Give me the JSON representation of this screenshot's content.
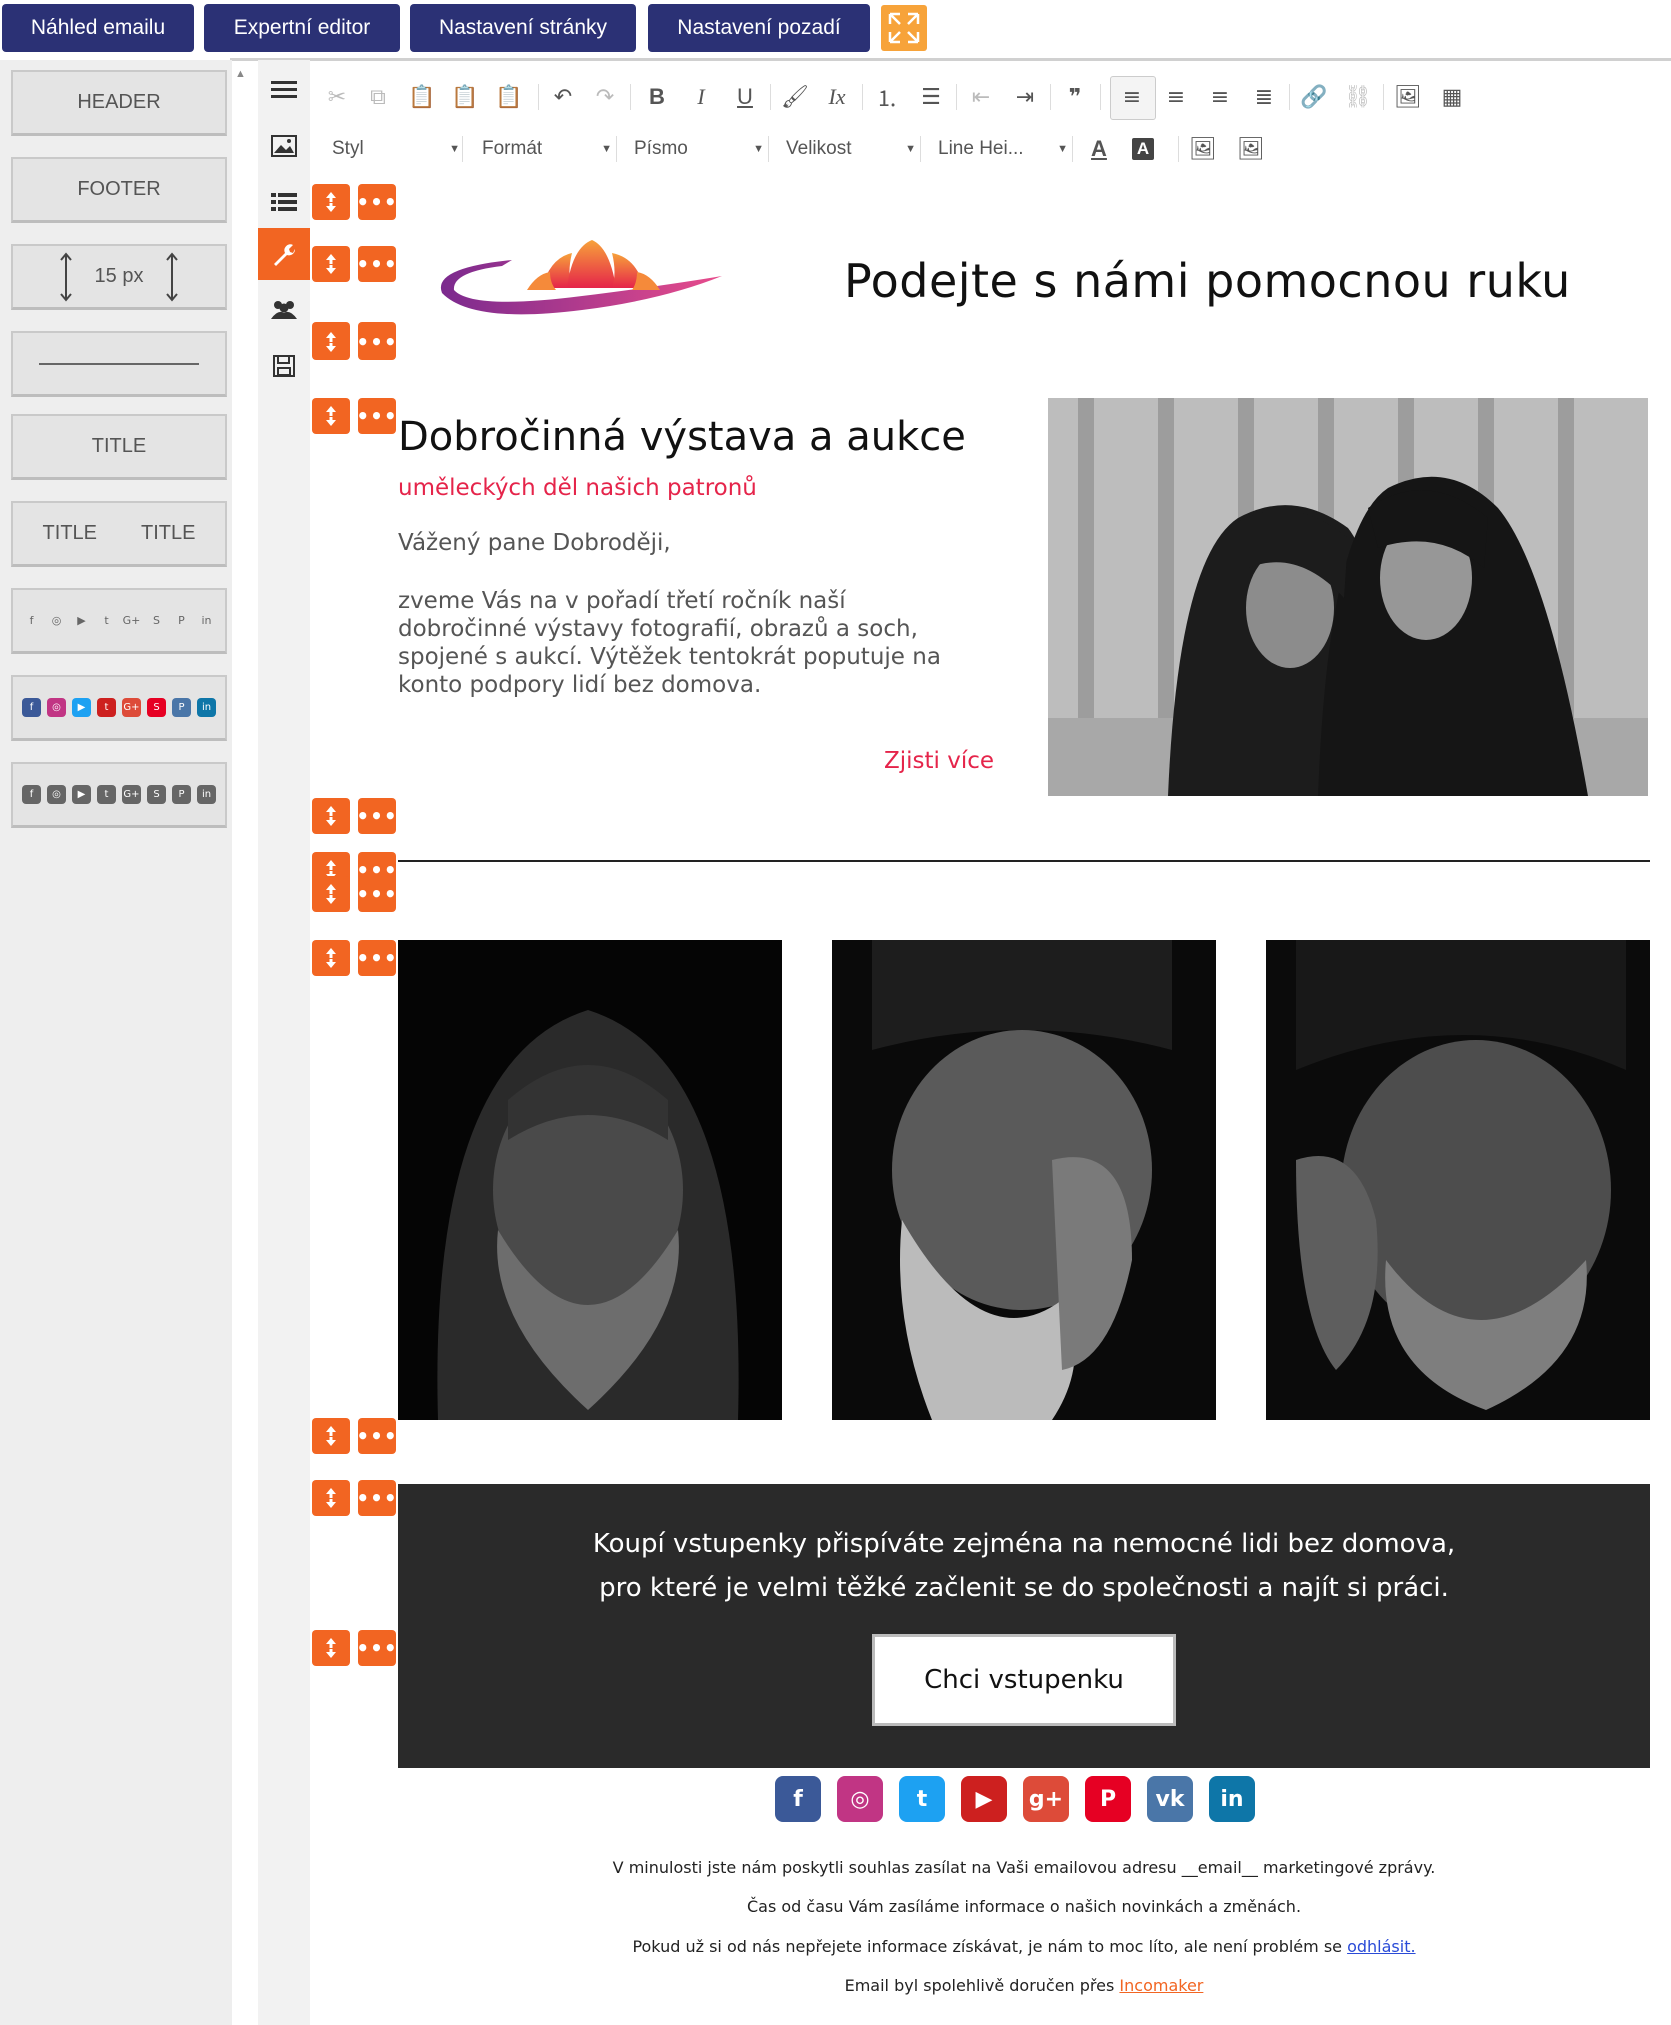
{
  "top_tabs": {
    "preview": "Náhled emailu",
    "expert": "Expertní editor",
    "page_settings": "Nastavení stránky",
    "background_settings": "Nastavení pozadí"
  },
  "palette": {
    "header": "HEADER",
    "footer": "FOOTER",
    "spacer": "15 px",
    "title": "TITLE",
    "title_left": "TITLE",
    "title_right": "TITLE",
    "social_glyphs": [
      "f",
      "◎",
      "▶",
      "t",
      "G+",
      "S",
      "P",
      "in"
    ]
  },
  "toolbar": {
    "style": "Styl",
    "format": "Formát",
    "font": "Písmo",
    "size": "Velikost",
    "line_height": "Line Hei..."
  },
  "email": {
    "headline": "Podejte s námi pomocnou ruku",
    "title": "Dobročinná výstava a aukce",
    "subtitle": "uměleckých děl našich patronů",
    "greeting": "Vážený pane Dobroději,",
    "body": "zveme Vás na v pořadí třetí ročník naší dobročinné výstavy fotografií, obrazů a soch, spojené s aukcí. Výtěžek tentokrát poputuje na konto podpory lidí bez domova.",
    "more_link": "Zjisti více",
    "cta_line1": "Koupí vstupenky přispíváte zejména na nemocné lidi bez domova,",
    "cta_line2": "pro které je velmi těžké začlenit se do společnosti a najít si práci.",
    "cta_button": "Chci vstupenku"
  },
  "social_icons": [
    {
      "name": "facebook",
      "glyph": "f",
      "color": "#3b5998"
    },
    {
      "name": "instagram",
      "glyph": "◎",
      "color": "#c13584"
    },
    {
      "name": "twitter",
      "glyph": "t",
      "color": "#1da1f2"
    },
    {
      "name": "youtube",
      "glyph": "▶",
      "color": "#cd201f"
    },
    {
      "name": "google-plus",
      "glyph": "g+",
      "color": "#dd4b39"
    },
    {
      "name": "pinterest",
      "glyph": "P",
      "color": "#e60023"
    },
    {
      "name": "vk",
      "glyph": "vk",
      "color": "#4a76a8"
    },
    {
      "name": "linkedin",
      "glyph": "in",
      "color": "#0e76a8"
    }
  ],
  "footer": {
    "line1": "V minulosti jste nám poskytli souhlas zasílat na Vaši emailovou adresu __email__ marketingové zprávy.",
    "line2": "Čas od času Vám zasíláme informace o našich novinkách a změnách.",
    "line3_text": "Pokud už si od nás nepřejete informace získávat, je nám to moc líto, ale není problém se ",
    "line3_link": "odhlásit.",
    "line4_text": "Email byl spolehlivě doručen přes ",
    "line4_link": "Incomaker"
  },
  "colors": {
    "tab_bg": "#2b3175",
    "accent_orange": "#f26522",
    "pink": "#e5244a",
    "cta_bg": "#2a2a2a"
  }
}
